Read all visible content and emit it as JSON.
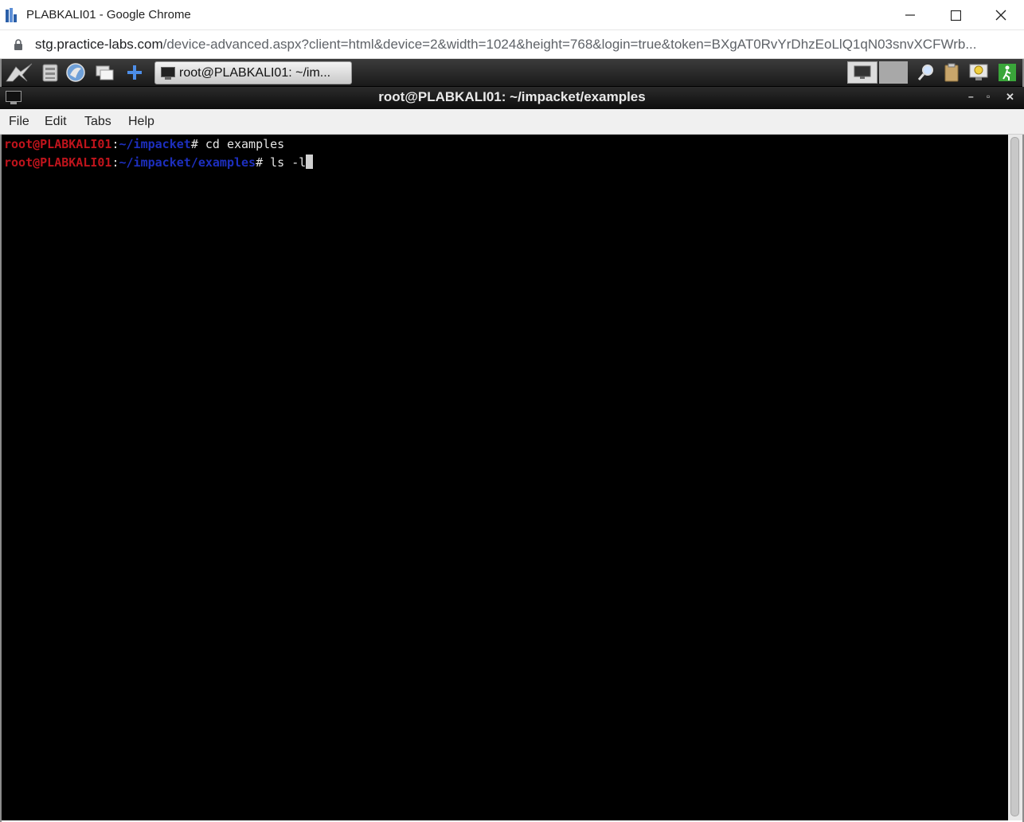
{
  "browser": {
    "window_title": "PLABKALI01 - Google Chrome",
    "url_host": "stg.practice-labs.com",
    "url_rest": "/device-advanced.aspx?client=html&device=2&width=1024&height=768&login=true&token=BXgAT0RvYrDhzEoLlQ1qN03snvXCFWrb..."
  },
  "panel": {
    "task_label": "root@PLABKALI01: ~/im..."
  },
  "terminal_window": {
    "title": "root@PLABKALI01: ~/impacket/examples",
    "menu": [
      "File",
      "Edit",
      "Tabs",
      "Help"
    ]
  },
  "terminal": {
    "lines": [
      {
        "user": "root@PLABKALI01",
        "sep": ":",
        "path": "~/impacket",
        "prompt": "# ",
        "cmd": "cd examples"
      },
      {
        "user": "root@PLABKALI01",
        "sep": ":",
        "path": "~/impacket/examples",
        "prompt": "# ",
        "cmd": "ls -l"
      }
    ]
  },
  "colors": {
    "prompt_user": "#c0141c",
    "prompt_path": "#1d2fbf",
    "terminal_bg": "#000000"
  }
}
